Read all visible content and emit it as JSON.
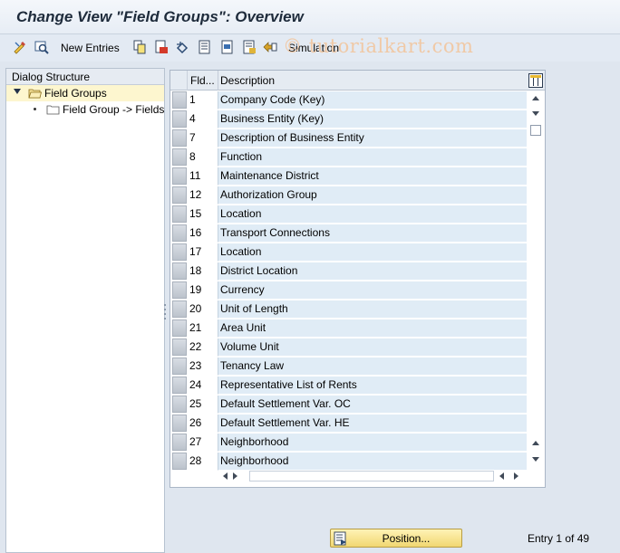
{
  "window": {
    "title": "Change View \"Field Groups\": Overview"
  },
  "toolbar": {
    "new_entries_label": "New Entries",
    "simulation_label": "Simulation",
    "watermark": "© tutorialkart.com",
    "icons": [
      "display-change-icon",
      "other-view-icon",
      "copy-icon",
      "delete-icon",
      "undo-icon",
      "select-all-icon",
      "select-block-icon",
      "deselect-all-icon",
      "transport-icon"
    ]
  },
  "dialog_structure": {
    "header": "Dialog Structure",
    "items": [
      {
        "label": "Field Groups",
        "level": 0,
        "selected": true,
        "expanded": true
      },
      {
        "label": "Field Group -> Fields",
        "level": 1,
        "selected": false
      }
    ]
  },
  "table": {
    "columns": [
      "Fld...",
      "Description"
    ],
    "rows": [
      {
        "fld": "1",
        "description": "Company Code (Key)"
      },
      {
        "fld": "4",
        "description": "Business Entity (Key)"
      },
      {
        "fld": "7",
        "description": "Description of Business Entity"
      },
      {
        "fld": "8",
        "description": "Function"
      },
      {
        "fld": "11",
        "description": "Maintenance District"
      },
      {
        "fld": "12",
        "description": "Authorization Group"
      },
      {
        "fld": "15",
        "description": "Location"
      },
      {
        "fld": "16",
        "description": "Transport Connections"
      },
      {
        "fld": "17",
        "description": "Location"
      },
      {
        "fld": "18",
        "description": "District Location"
      },
      {
        "fld": "19",
        "description": "Currency"
      },
      {
        "fld": "20",
        "description": "Unit of Length"
      },
      {
        "fld": "21",
        "description": "Area Unit"
      },
      {
        "fld": "22",
        "description": "Volume Unit"
      },
      {
        "fld": "23",
        "description": "Tenancy Law"
      },
      {
        "fld": "24",
        "description": "Representative List of Rents"
      },
      {
        "fld": "25",
        "description": "Default Settlement Var. OC"
      },
      {
        "fld": "26",
        "description": "Default Settlement Var. HE"
      },
      {
        "fld": "27",
        "description": "Neighborhood"
      },
      {
        "fld": "28",
        "description": "Neighborhood"
      }
    ]
  },
  "footer": {
    "position_button": "Position...",
    "entry_info": "Entry 1 of 49"
  },
  "colors": {
    "row_fill": "#e0ecf6",
    "selected_tree_row": "#fdf6cf",
    "button_fill": "#f1d771"
  }
}
